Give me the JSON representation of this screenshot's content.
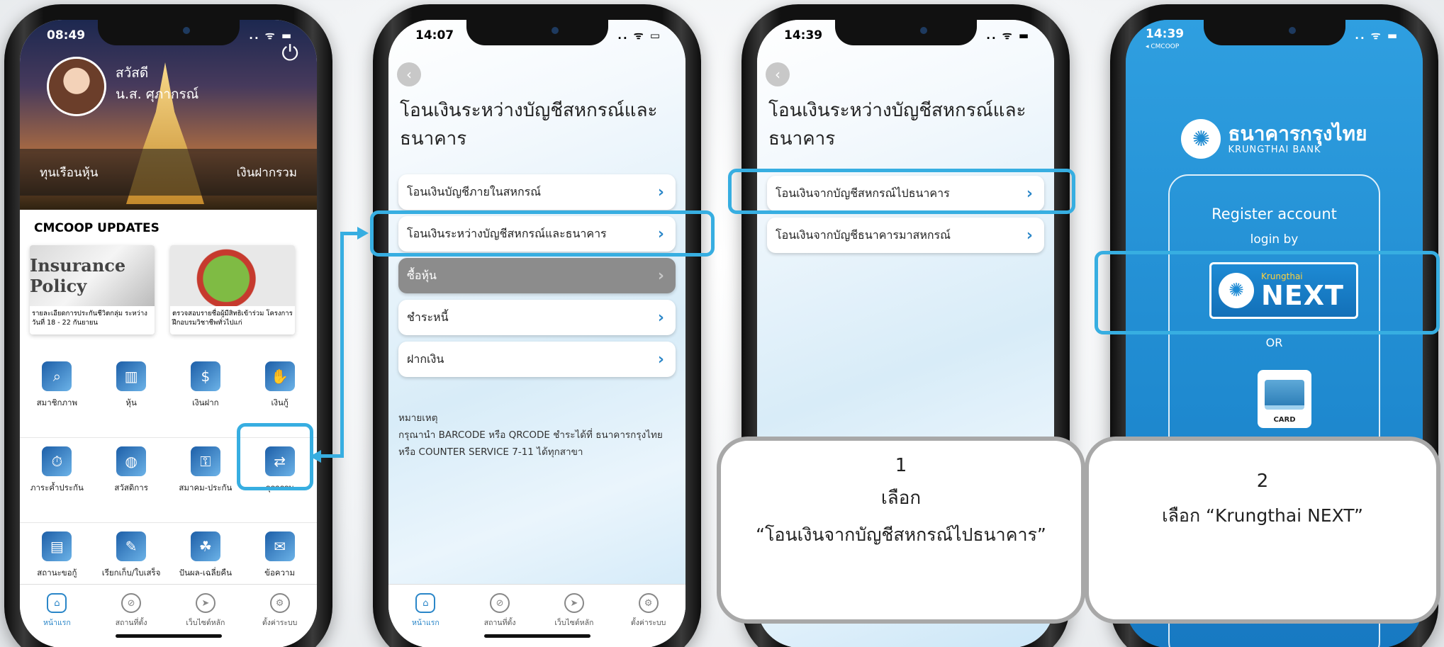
{
  "phone1": {
    "time": "08:49",
    "greeting": "สวัสดี",
    "user_name": "น.ส. ศุภากรณ์",
    "bar_left": "ทุนเรือนหุ้น",
    "bar_right": "เงินฝากรวม",
    "updates_title": "CMCOOP UPDATES",
    "cards": [
      {
        "image_text": "Insurance Policy",
        "caption": "รายละเอียดการประกันชีวิตกลุ่ม ระหว่างวันที่ 18 - 22 กันยายน"
      },
      {
        "caption": "ตรวจสอบรายชื่อผู้มีสิทธิเข้าร่วม โครงการฝึกอบรมวิชาชีพทั่วไปแก่"
      }
    ],
    "grid": [
      [
        {
          "label": "สมาชิกภาพ",
          "icon": "magnifier-icon"
        },
        {
          "label": "หุ้น",
          "icon": "bar-chart-icon"
        },
        {
          "label": "เงินฝาก",
          "icon": "money-bag-icon"
        },
        {
          "label": "เงินกู้",
          "icon": "cash-hand-icon"
        }
      ],
      [
        {
          "label": "ภาระค้ำประกัน",
          "icon": "stopwatch-icon"
        },
        {
          "label": "สวัสดิการ",
          "icon": "globe-icon"
        },
        {
          "label": "สมาคม-ประกัน",
          "icon": "lock-coin-icon"
        },
        {
          "label": "ธุรกรรม",
          "icon": "phone-transfer-icon"
        }
      ],
      [
        {
          "label": "สถานะขอกู้",
          "icon": "loan-status-icon"
        },
        {
          "label": "เรียกเก็บ/ใบเสร็จ",
          "icon": "receipt-icon"
        },
        {
          "label": "ปันผล-เฉลี่ยคืน",
          "icon": "dividend-icon"
        },
        {
          "label": "ข้อความ",
          "icon": "mail-icon"
        }
      ]
    ]
  },
  "tabs": [
    "หน้าแรก",
    "สถานที่ตั้ง",
    "เว็บไซต์หลัก",
    "ตั้งค่าระบบ"
  ],
  "phone2": {
    "time": "14:07",
    "title": "โอนเงินระหว่างบัญชีสหกรณ์และธนาคาร",
    "menu": [
      "โอนเงินบัญชีภายในสหกรณ์",
      "โอนเงินระหว่างบัญชีสหกรณ์และธนาคาร",
      "ซื้อหุ้น",
      "ชำระหนี้",
      "ฝากเงิน"
    ],
    "note_title": "หมายเหตุ",
    "note_body": "กรุณานำ BARCODE หรือ QRCODE ชำระได้ที่ ธนาคารกรุงไทย หรือ COUNTER SERVICE 7-11 ได้ทุกสาขา"
  },
  "phone3": {
    "time": "14:39",
    "title": "โอนเงินระหว่างบัญชีสหกรณ์และธนาคาร",
    "menu": [
      "โอนเงินจากบัญชีสหกรณ์ไปธนาคาร",
      "โอนเงินจากบัญชีธนาคารมาสหกรณ์"
    ]
  },
  "phone4": {
    "time": "14:39",
    "back_label": "◂ CMCOOP",
    "bank_th": "ธนาคารกรุงไทย",
    "bank_en": "KRUNGTHAI BANK",
    "register": "Register account",
    "login_by": "login by",
    "next_small": "Krungthai",
    "next_big": "NEXT",
    "or": "OR",
    "card": "CARD"
  },
  "callout1": {
    "step": "1",
    "line1": "เลือก",
    "line2": "“โอนเงินจากบัญชีสหกรณ์ไปธนาคาร”"
  },
  "callout2": {
    "step": "2",
    "line1": "เลือก “Krungthai NEXT”"
  },
  "colors": {
    "highlight": "#37aee1",
    "link": "#2a86c8",
    "krungthai": "#1f8ad0"
  }
}
